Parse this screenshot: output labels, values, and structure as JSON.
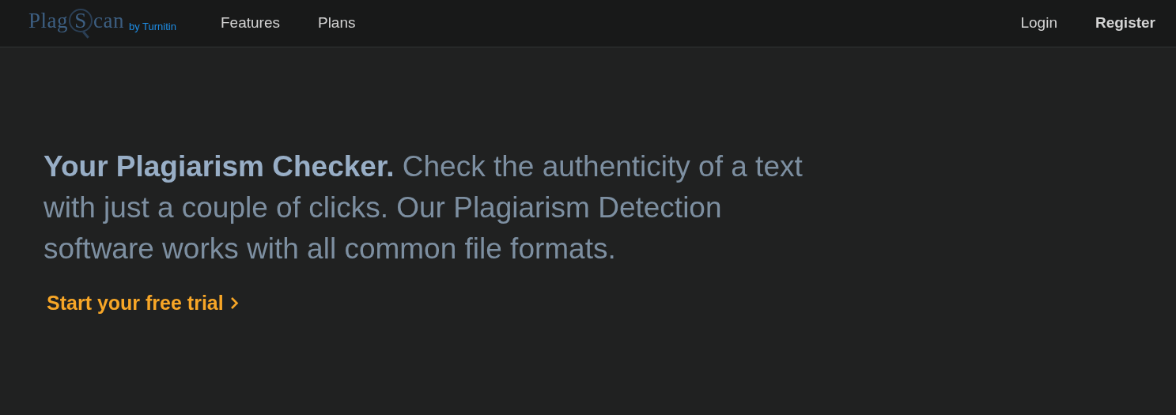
{
  "navbar": {
    "logo": [
      {
        "kind": "plain",
        "text": "Plag"
      },
      {
        "kind": "lens",
        "text": "S"
      },
      {
        "kind": "plain",
        "text": "can"
      }
    ],
    "tagline": "by Turnitin",
    "links": [
      {
        "label": "Features"
      },
      {
        "label": "Plans"
      }
    ],
    "account_links": [
      {
        "label": "Login",
        "emphasis": false
      },
      {
        "label": "Register",
        "emphasis": true
      }
    ]
  },
  "hero": {
    "text": "**Your Plagiarism Checker.** Check the authenticity of a text with just a couple of clicks. Our Plagiarism Detection software works with all common file formats.",
    "cta": "Start your free trial"
  }
}
